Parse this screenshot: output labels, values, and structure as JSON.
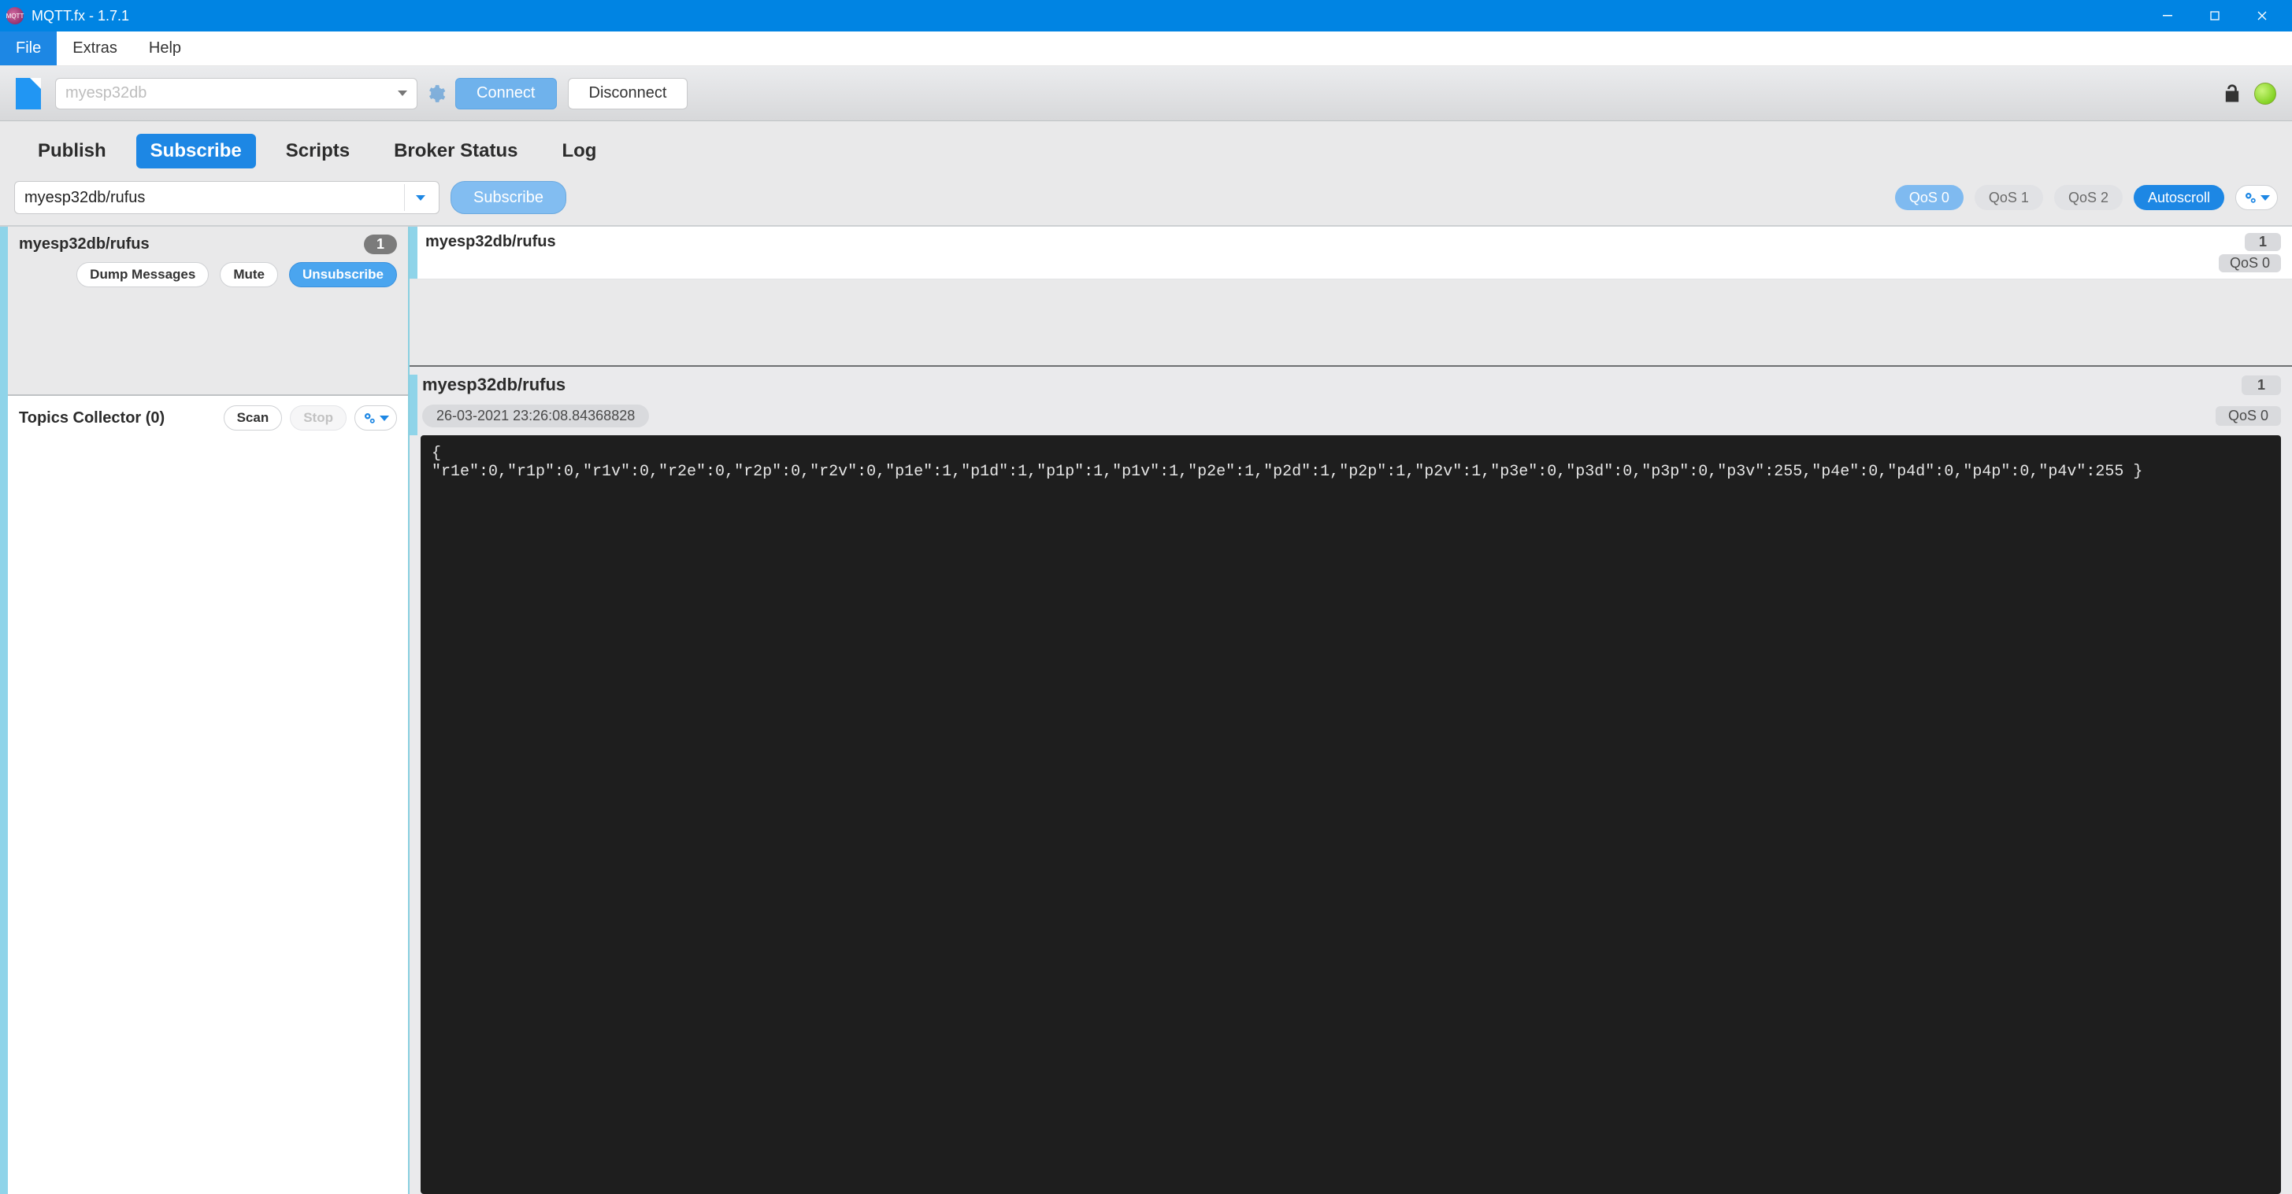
{
  "window": {
    "title": "MQTT.fx - 1.7.1"
  },
  "menu": {
    "file": "File",
    "extras": "Extras",
    "help": "Help"
  },
  "connection": {
    "profile_placeholder": "myesp32db",
    "connect": "Connect",
    "disconnect": "Disconnect"
  },
  "tabs": {
    "publish": "Publish",
    "subscribe": "Subscribe",
    "scripts": "Scripts",
    "broker_status": "Broker Status",
    "log": "Log"
  },
  "subscribe": {
    "topic_input": "myesp32db/rufus",
    "subscribe_btn": "Subscribe",
    "qos0": "QoS 0",
    "qos1": "QoS 1",
    "qos2": "QoS 2",
    "autoscroll": "Autoscroll"
  },
  "subscriptions": [
    {
      "topic": "myesp32db/rufus",
      "count": "1",
      "dump": "Dump Messages",
      "mute": "Mute",
      "unsubscribe": "Unsubscribe"
    }
  ],
  "collector": {
    "title": "Topics Collector (0)",
    "scan": "Scan",
    "stop": "Stop"
  },
  "messages": [
    {
      "topic": "myesp32db/rufus",
      "count": "1",
      "qos": "QoS 0"
    }
  ],
  "detail": {
    "topic": "myesp32db/rufus",
    "count": "1",
    "timestamp": "26-03-2021  23:26:08.84368828",
    "qos": "QoS 0",
    "payload": "{\n\"r1e\":0,\"r1p\":0,\"r1v\":0,\"r2e\":0,\"r2p\":0,\"r2v\":0,\"p1e\":1,\"p1d\":1,\"p1p\":1,\"p1v\":1,\"p2e\":1,\"p2d\":1,\"p2p\":1,\"p2v\":1,\"p3e\":0,\"p3d\":0,\"p3p\":0,\"p3v\":255,\"p4e\":0,\"p4d\":0,\"p4p\":0,\"p4v\":255 }"
  }
}
